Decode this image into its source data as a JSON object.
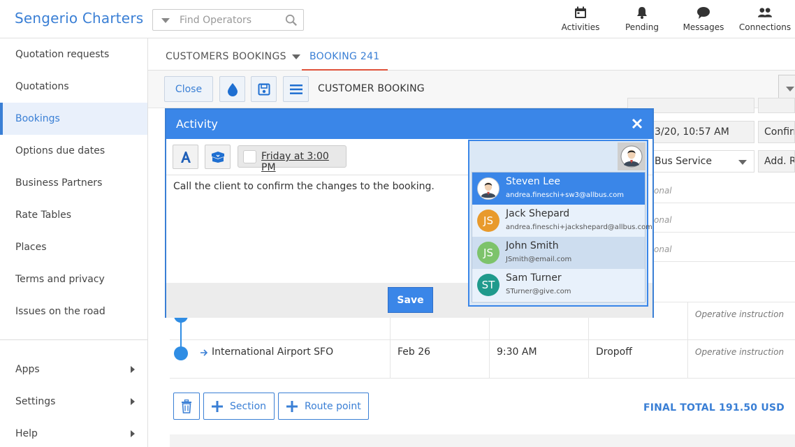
{
  "header": {
    "brand": "Sengerio Charters",
    "search_placeholder": "Find Operators",
    "nav": [
      {
        "label": "Activities",
        "icon": "calendar-icon"
      },
      {
        "label": "Pending",
        "icon": "bell-icon"
      },
      {
        "label": "Messages",
        "icon": "chat-icon"
      },
      {
        "label": "Connections",
        "icon": "users-icon"
      }
    ]
  },
  "sidebar": {
    "items": [
      {
        "label": "Quotation requests"
      },
      {
        "label": "Quotations"
      },
      {
        "label": "Bookings"
      },
      {
        "label": "Options due dates"
      },
      {
        "label": "Business Partners"
      },
      {
        "label": "Rate Tables"
      },
      {
        "label": "Places"
      },
      {
        "label": "Terms and privacy"
      },
      {
        "label": "Issues on the road"
      }
    ],
    "bottom": [
      {
        "label": "Apps"
      },
      {
        "label": "Settings"
      },
      {
        "label": "Help"
      }
    ]
  },
  "tabs": {
    "customers_bookings": "CUSTOMERS BOOKINGS",
    "booking": "BOOKING 241"
  },
  "toolbar": {
    "close_label": "Close",
    "title": "CUSTOMER BOOKING"
  },
  "background_form": {
    "datetime": "3/20, 10:57 AM",
    "confirm": "Confirm",
    "service": "Bus Service",
    "add_route": "Add. Ro",
    "optional": "onal"
  },
  "route": {
    "rows": [
      {
        "place": "International Airport SFO",
        "date": "Feb 26",
        "time": "9:30 AM",
        "type": "Dropoff",
        "note": "Operative instruction"
      }
    ],
    "row_prev_note": "Operative instruction",
    "section_label": "Section",
    "route_point_label": "Route point",
    "final_total": "FINAL TOTAL 191.50 USD"
  },
  "activity_modal": {
    "title": "Activity",
    "due_label": "Friday at 3:00 PM",
    "text": "Call the client to confirm the changes to the booking.",
    "save_label": "Save"
  },
  "assignees": [
    {
      "name": "Steven Lee",
      "email": "andrea.fineschi+sw3@allbus.com",
      "initials": "",
      "color": "#3a86e8",
      "selected": true
    },
    {
      "name": "Jack Shepard",
      "email": "andrea.fineschi+jackshepard@allbus.com",
      "initials": "JS",
      "color": "#e89a2c"
    },
    {
      "name": "John Smith",
      "email": "JSmith@email.com",
      "initials": "JS",
      "color": "#7dc36b"
    },
    {
      "name": "Sam Turner",
      "email": "STurner@give.com",
      "initials": "ST",
      "color": "#1f9a8c"
    }
  ],
  "colors": {
    "accent": "#3a7fd5",
    "tab_underline": "#e0523a"
  }
}
